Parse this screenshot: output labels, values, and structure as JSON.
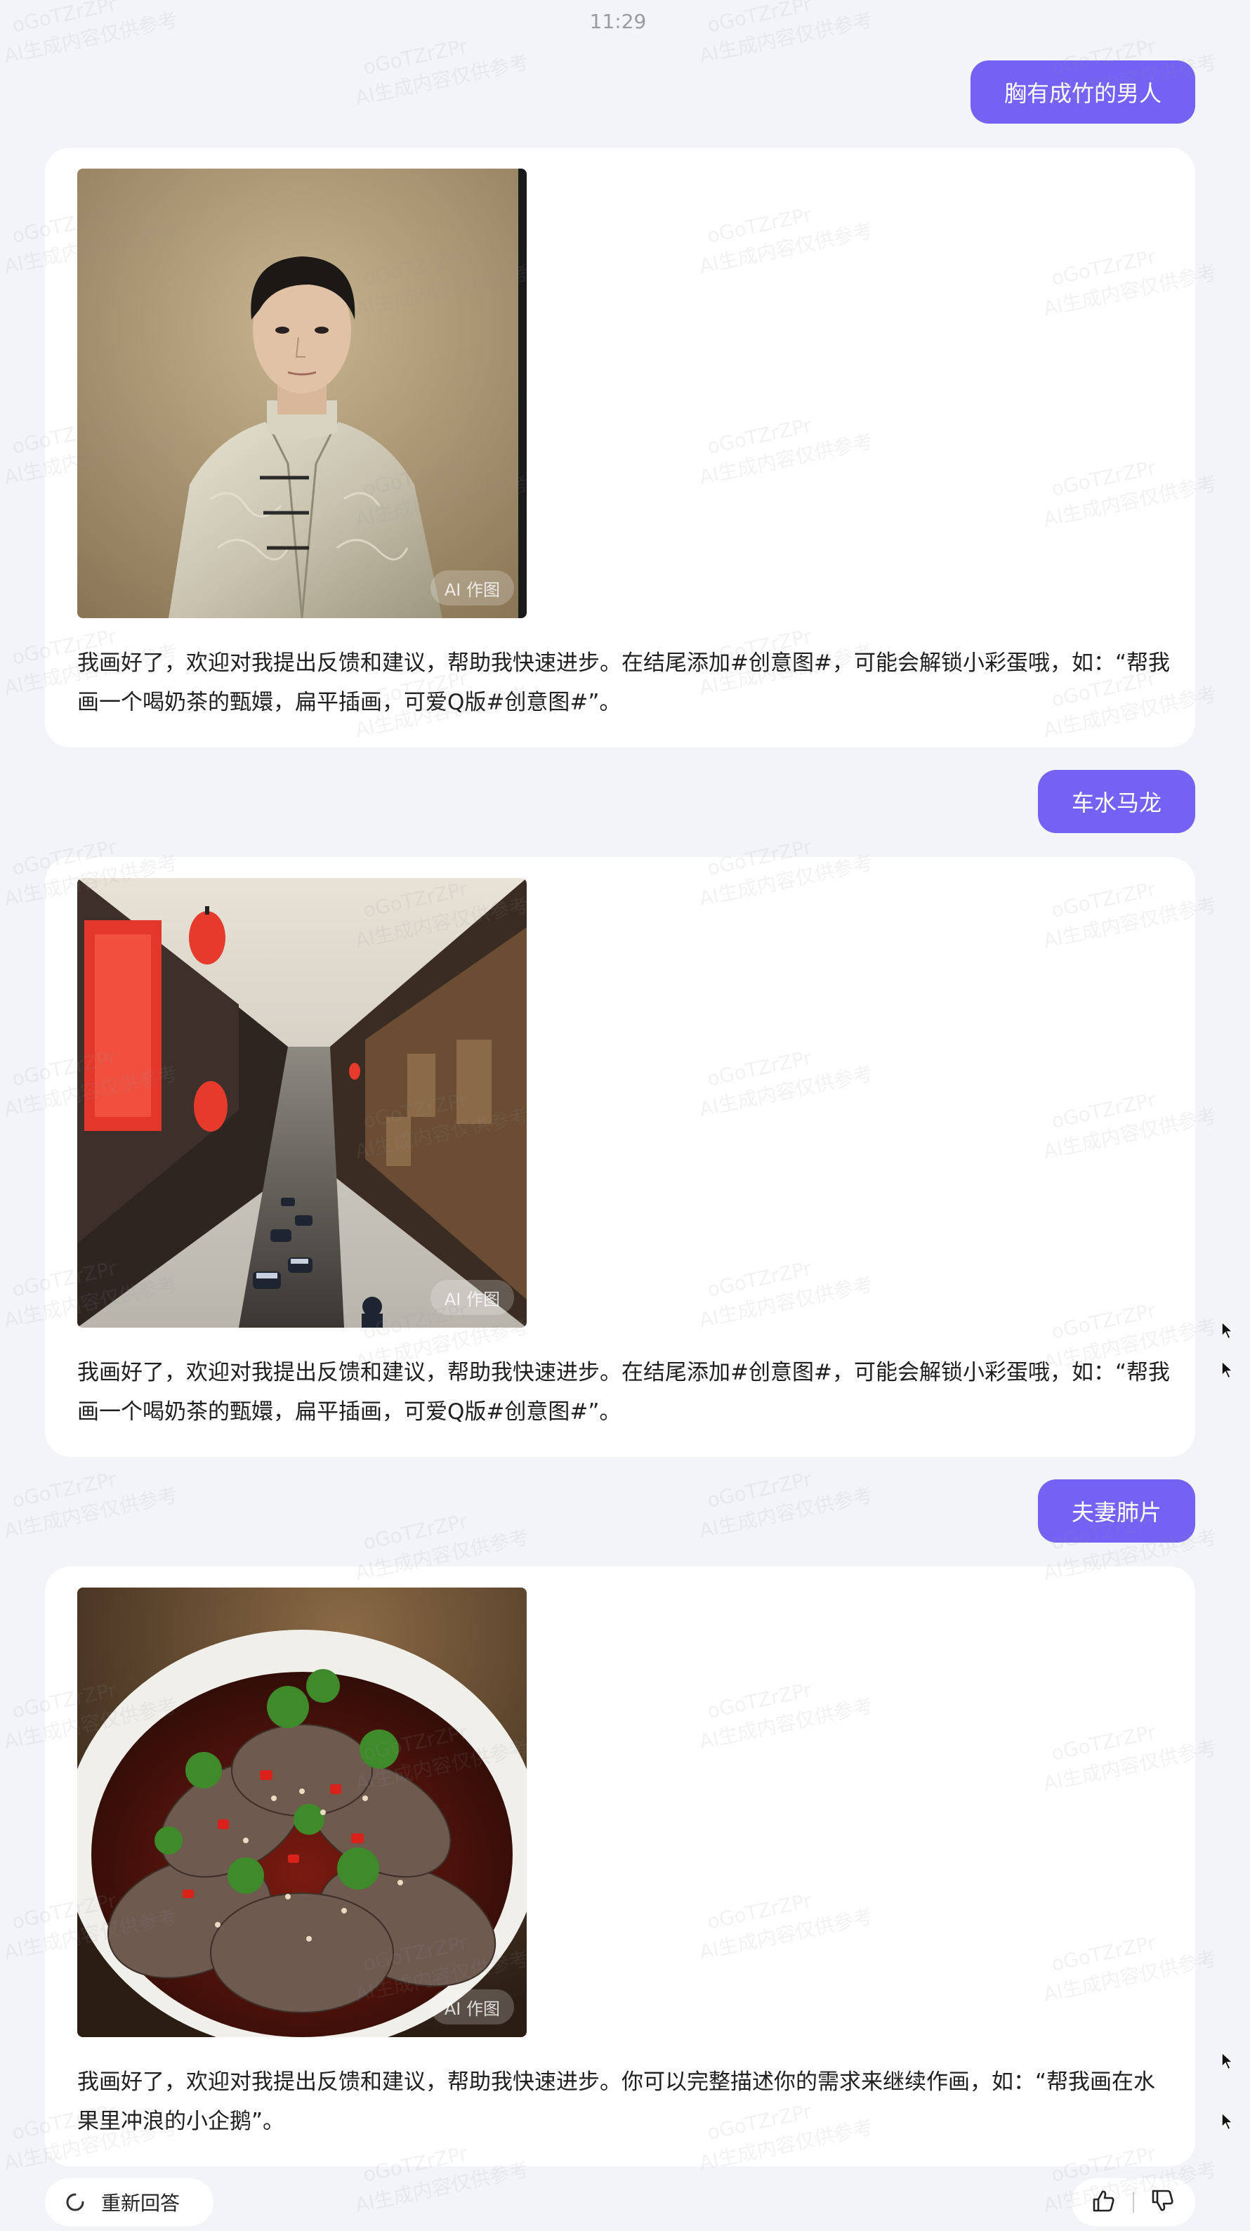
{
  "status_time": "11:29",
  "conversation": [
    {
      "prompt": "胸有成竹的男人",
      "image_subject": "man in embroidered Chinese jacket portrait",
      "image_tag": "AI 作图",
      "reply": "我画好了，欢迎对我提出反馈和建议，帮助我快速进步。在结尾添加#创意图#，可能会解锁小彩蛋哦，如：“帮我画一个喝奶茶的甄嬛，扁平插画，可爱Q版#创意图#”。"
    },
    {
      "prompt": "车水马龙",
      "image_subject": "busy old town street with red lanterns and traffic",
      "image_tag": "AI 作图",
      "reply": "我画好了，欢迎对我提出反馈和建议，帮助我快速进步。在结尾添加#创意图#，可能会解锁小彩蛋哦，如：“帮我画一个喝奶茶的甄嬛，扁平插画，可爱Q版#创意图#”。"
    },
    {
      "prompt": "夫妻肺片",
      "image_subject": "sichuan beef slices in chili oil with cilantro",
      "image_tag": "AI 作图",
      "reply": "我画好了，欢迎对我提出反馈和建议，帮助我快速进步。你可以完整描述你的需求来继续作画，如：“帮我画在水果里冲浪的小企鹅”。"
    }
  ],
  "actions": {
    "regenerate_label": "重新回答",
    "regenerate_icon": "refresh-icon",
    "like_icon": "thumbs-up-icon",
    "dislike_icon": "thumbs-down-icon"
  },
  "watermark": {
    "code": "oGoTZrZPr",
    "text": "AI生成内容仅供参考"
  },
  "colors": {
    "accent": "#7362f3",
    "background": "#f3f4f8",
    "card": "#ffffff"
  }
}
